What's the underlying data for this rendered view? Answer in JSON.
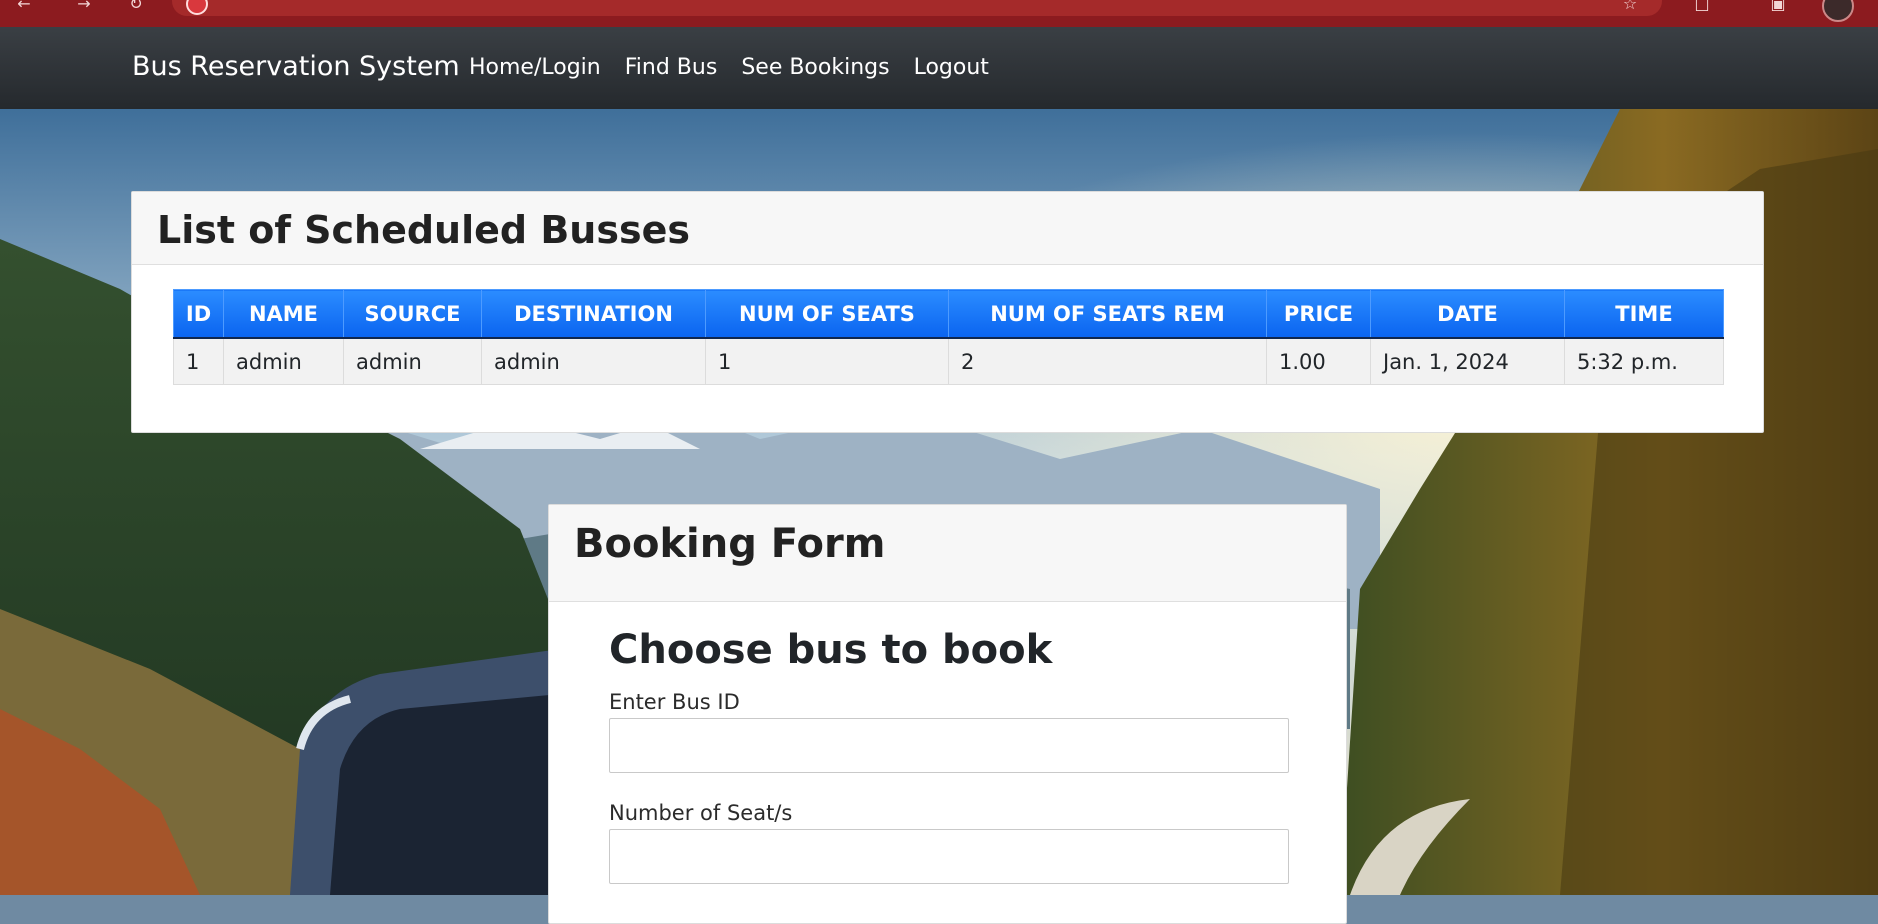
{
  "app": {
    "brand": "Bus Reservation System"
  },
  "nav": {
    "links": [
      "Home/Login",
      "Find Bus",
      "See Bookings",
      "Logout"
    ]
  },
  "schedule": {
    "title": "List of Scheduled Busses",
    "columns": [
      "ID",
      "NAME",
      "SOURCE",
      "DESTINATION",
      "NUM OF SEATS",
      "NUM OF SEATS REM",
      "PRICE",
      "DATE",
      "TIME"
    ],
    "rows": [
      [
        "1",
        "admin",
        "admin",
        "admin",
        "1",
        "2",
        "1.00",
        "Jan. 1, 2024",
        "5:32 p.m."
      ]
    ]
  },
  "booking": {
    "title": "Booking Form",
    "heading": "Choose bus to book",
    "bus_id_label": "Enter Bus ID",
    "bus_id_value": "",
    "seats_label": "Number of Seat/s",
    "seats_value": ""
  },
  "colors": {
    "navbar": "#2f3337",
    "table_header": "#1a77f7",
    "browser_bar": "#8c1b1f"
  }
}
